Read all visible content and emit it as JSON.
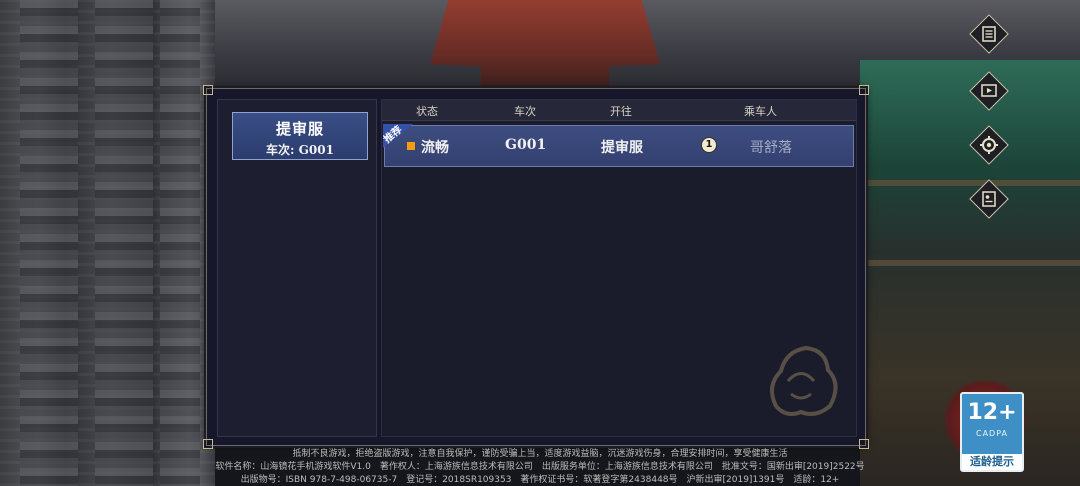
{
  "server_list": [
    {
      "name": "提审服",
      "code_label": "车次: G001"
    }
  ],
  "table": {
    "headers": [
      "状态",
      "车次",
      "开往",
      "乘车人"
    ],
    "rows": [
      {
        "tag": "推荐",
        "status_color": "#f39c12",
        "status": "流畅",
        "code": "G001",
        "destination": "提审服",
        "count": "1",
        "passenger": "哥舒落"
      }
    ]
  },
  "side_menu": [
    {
      "icon": "list-icon"
    },
    {
      "icon": "video-icon"
    },
    {
      "icon": "settings-icon"
    },
    {
      "icon": "id-card-icon"
    }
  ],
  "footer": {
    "line1": "抵制不良游戏，拒绝盗版游戏，注意自我保护，谨防受骗上当，适度游戏益脑，沉迷游戏伤身，合理安排时间，享受健康生活",
    "line2": "软件名称：山海镜花手机游戏软件V1.0　著作权人：上海游族信息技术有限公司　出版服务单位：上海游族信息技术有限公司　批准文号：国新出审[2019]2522号",
    "line3": "出版物号：ISBN 978-7-498-06735-7　登记号：2018SR109353　著作权证书号：软著登字第2438448号　沪新出审[2019]1391号　适龄：12+"
  },
  "age_rating": {
    "number": "12+",
    "org": "CADPA",
    "tip": "适龄提示"
  },
  "colors": {
    "panel_bg": "#16172a",
    "row_selected": "#3e4d80",
    "status_smooth": "#f39c12",
    "age_badge": "#3e8fc6"
  }
}
